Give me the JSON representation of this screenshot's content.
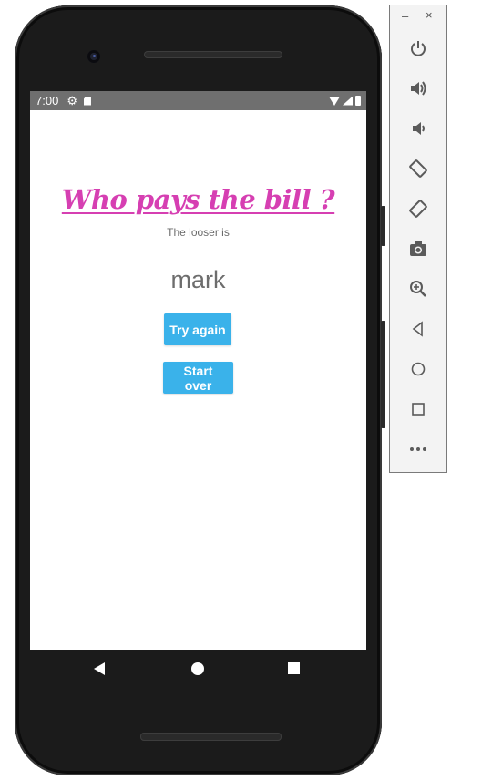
{
  "status_bar": {
    "time": "7:00",
    "icons": [
      "settings-gear-icon",
      "sd-card-icon",
      "wifi-icon",
      "cell-signal-icon",
      "battery-icon"
    ]
  },
  "app": {
    "title": "Who pays the bill ?",
    "subtitle": "The looser is",
    "loser_name": "mark",
    "try_again_label": "Try again",
    "start_over_label": "Start over",
    "title_color": "#d63fb2",
    "button_color": "#3ab2ea"
  },
  "navigation": {
    "icons": [
      "back-icon",
      "home-icon",
      "recents-icon"
    ]
  },
  "emulator_panel": {
    "window_minimize": "–",
    "window_close": "×",
    "tools": [
      {
        "name": "power-icon",
        "glyph": "⏻"
      },
      {
        "name": "volume-up-icon",
        "glyph": "🔊"
      },
      {
        "name": "volume-down-icon",
        "glyph": "🔉"
      },
      {
        "name": "rotate-left-icon",
        "glyph": "⟲"
      },
      {
        "name": "rotate-right-icon",
        "glyph": "⟳"
      },
      {
        "name": "camera-icon",
        "glyph": "📷"
      },
      {
        "name": "zoom-icon",
        "glyph": "🔍"
      },
      {
        "name": "back-nav-icon",
        "glyph": "◁"
      },
      {
        "name": "home-nav-icon",
        "glyph": "○"
      },
      {
        "name": "overview-nav-icon",
        "glyph": "□"
      },
      {
        "name": "more-icon",
        "glyph": "•••"
      }
    ]
  }
}
